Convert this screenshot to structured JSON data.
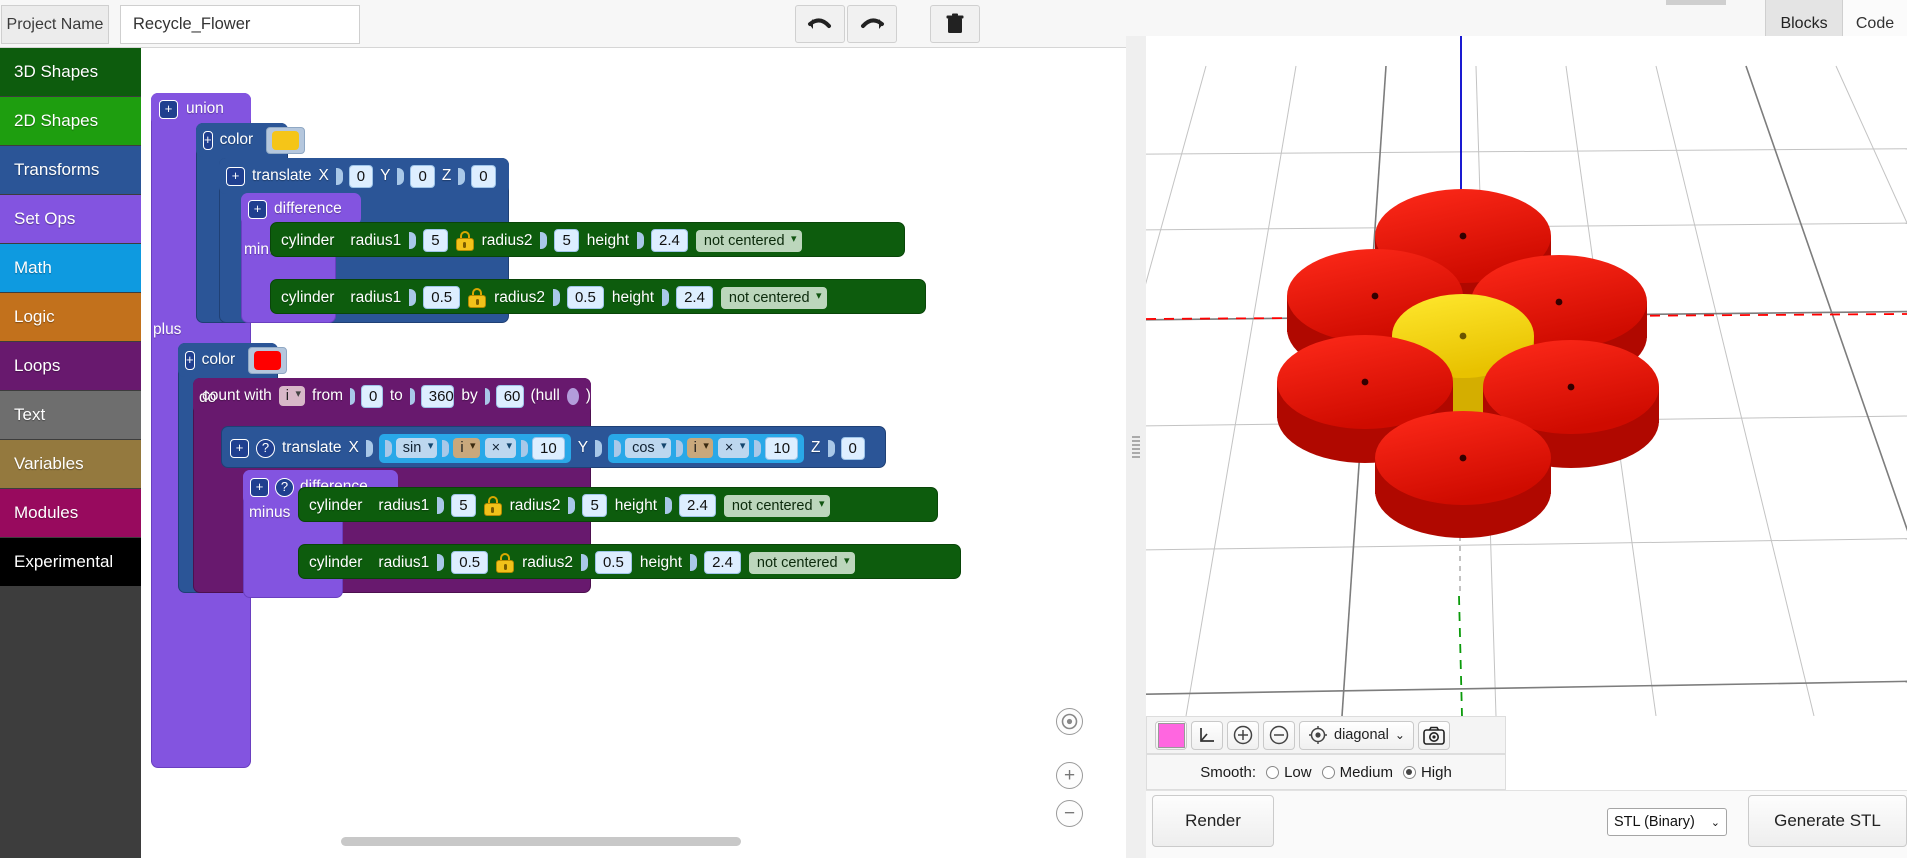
{
  "topbar": {
    "project_name_label": "Project Name",
    "project_name_value": "Recycle_Flower",
    "undo_icon": "undo-arrow-icon",
    "redo_icon": "redo-arrow-icon",
    "trash_icon": "trash-icon",
    "tab_blocks": "Blocks",
    "tab_code": "Code"
  },
  "sidebar": {
    "items": [
      {
        "label": "3D Shapes",
        "color": "#0d5c0d"
      },
      {
        "label": "2D Shapes",
        "color": "#1e9e0f"
      },
      {
        "label": "Transforms",
        "color": "#2b5597"
      },
      {
        "label": "Set Ops",
        "color": "#8354e0"
      },
      {
        "label": "Math",
        "color": "#0e9ae0"
      },
      {
        "label": "Logic",
        "color": "#c2711c"
      },
      {
        "label": "Loops",
        "color": "#68196e"
      },
      {
        "label": "Text",
        "color": "#6e6e6e"
      },
      {
        "label": "Variables",
        "color": "#94793e"
      },
      {
        "label": "Modules",
        "color": "#980a5e"
      },
      {
        "label": "Experimental",
        "color": "#000000"
      }
    ]
  },
  "blocks": {
    "union": {
      "label": "union",
      "expand": "+"
    },
    "color_yellow": {
      "label": "color",
      "swatch": "#f5c518",
      "expand": "+"
    },
    "translate_top": {
      "label": "translate",
      "x_label": "X",
      "x_value": "0",
      "y_label": "Y",
      "y_value": "0",
      "z_label": "Z",
      "z_value": "0",
      "expand": "+"
    },
    "difference_top": {
      "label": "difference",
      "expand": "+"
    },
    "cyl_top_outer": {
      "name": "cylinder",
      "radius1_label": "radius1",
      "radius1": "5",
      "lock": "lock-icon",
      "radius2_label": "radius2",
      "radius2": "5",
      "height_label": "height",
      "height": "2.4",
      "centering": "not centered"
    },
    "minus_top": {
      "label": "minus"
    },
    "cyl_top_inner": {
      "name": "cylinder",
      "radius1_label": "radius1",
      "radius1": "0.5",
      "lock": "lock-icon",
      "radius2_label": "radius2",
      "radius2": "0.5",
      "height_label": "height",
      "height": "2.4",
      "centering": "not centered"
    },
    "plus_label": "plus",
    "color_red": {
      "label": "color",
      "swatch": "#ff0000",
      "expand": "+"
    },
    "count_with": {
      "prefix": "count with",
      "var": "i",
      "from_label": "from",
      "from": "0",
      "to_label": "to",
      "to": "360",
      "by_label": "by",
      "by": "60",
      "hull_open": "(hull",
      "hull_close": ")"
    },
    "do_label": "do",
    "translate_loop": {
      "label": "translate",
      "x_label": "X",
      "x_fn": "sin",
      "x_var": "i",
      "x_op": "×",
      "x_num": "10",
      "y_label": "Y",
      "y_fn": "cos",
      "y_var": "i",
      "y_op": "×",
      "y_num": "10",
      "z_label": "Z",
      "z_value": "0",
      "expand": "+",
      "help": "?"
    },
    "difference_loop": {
      "label": "difference",
      "expand": "+",
      "help": "?"
    },
    "cyl_loop_outer": {
      "name": "cylinder",
      "radius1_label": "radius1",
      "radius1": "5",
      "lock": "lock-icon",
      "radius2_label": "radius2",
      "radius2": "5",
      "height_label": "height",
      "height": "2.4",
      "centering": "not centered"
    },
    "minus_loop": {
      "label": "minus"
    },
    "cyl_loop_inner": {
      "name": "cylinder",
      "radius1_label": "radius1",
      "radius1": "0.5",
      "lock": "lock-icon",
      "radius2_label": "radius2",
      "radius2": "0.5",
      "height_label": "height",
      "height": "2.4",
      "centering": "not centered"
    }
  },
  "canvas_controls": {
    "center_icon": "center-target-icon",
    "zoom_in": "+",
    "zoom_out": "−"
  },
  "viewer": {
    "model_colors": {
      "center": "#f5d400",
      "petal": "#ee1111"
    },
    "axis_colors": {
      "x": "#ff0000",
      "y": "#00a000",
      "z": "#0000ff"
    },
    "toolbar": {
      "color_swatch": "#ff66e0",
      "axes_icon": "axes-icon",
      "zoom_in_icon": "zoom-in-icon",
      "zoom_out_icon": "zoom-out-icon",
      "view_icon": "view-target-icon",
      "view_mode": "diagonal",
      "camera_icon": "camera-icon"
    },
    "smooth": {
      "label": "Smooth:",
      "options": [
        "Low",
        "Medium",
        "High"
      ],
      "selected": "High"
    },
    "render_button": "Render",
    "stl_format": "STL (Binary)",
    "generate_button": "Generate STL"
  }
}
